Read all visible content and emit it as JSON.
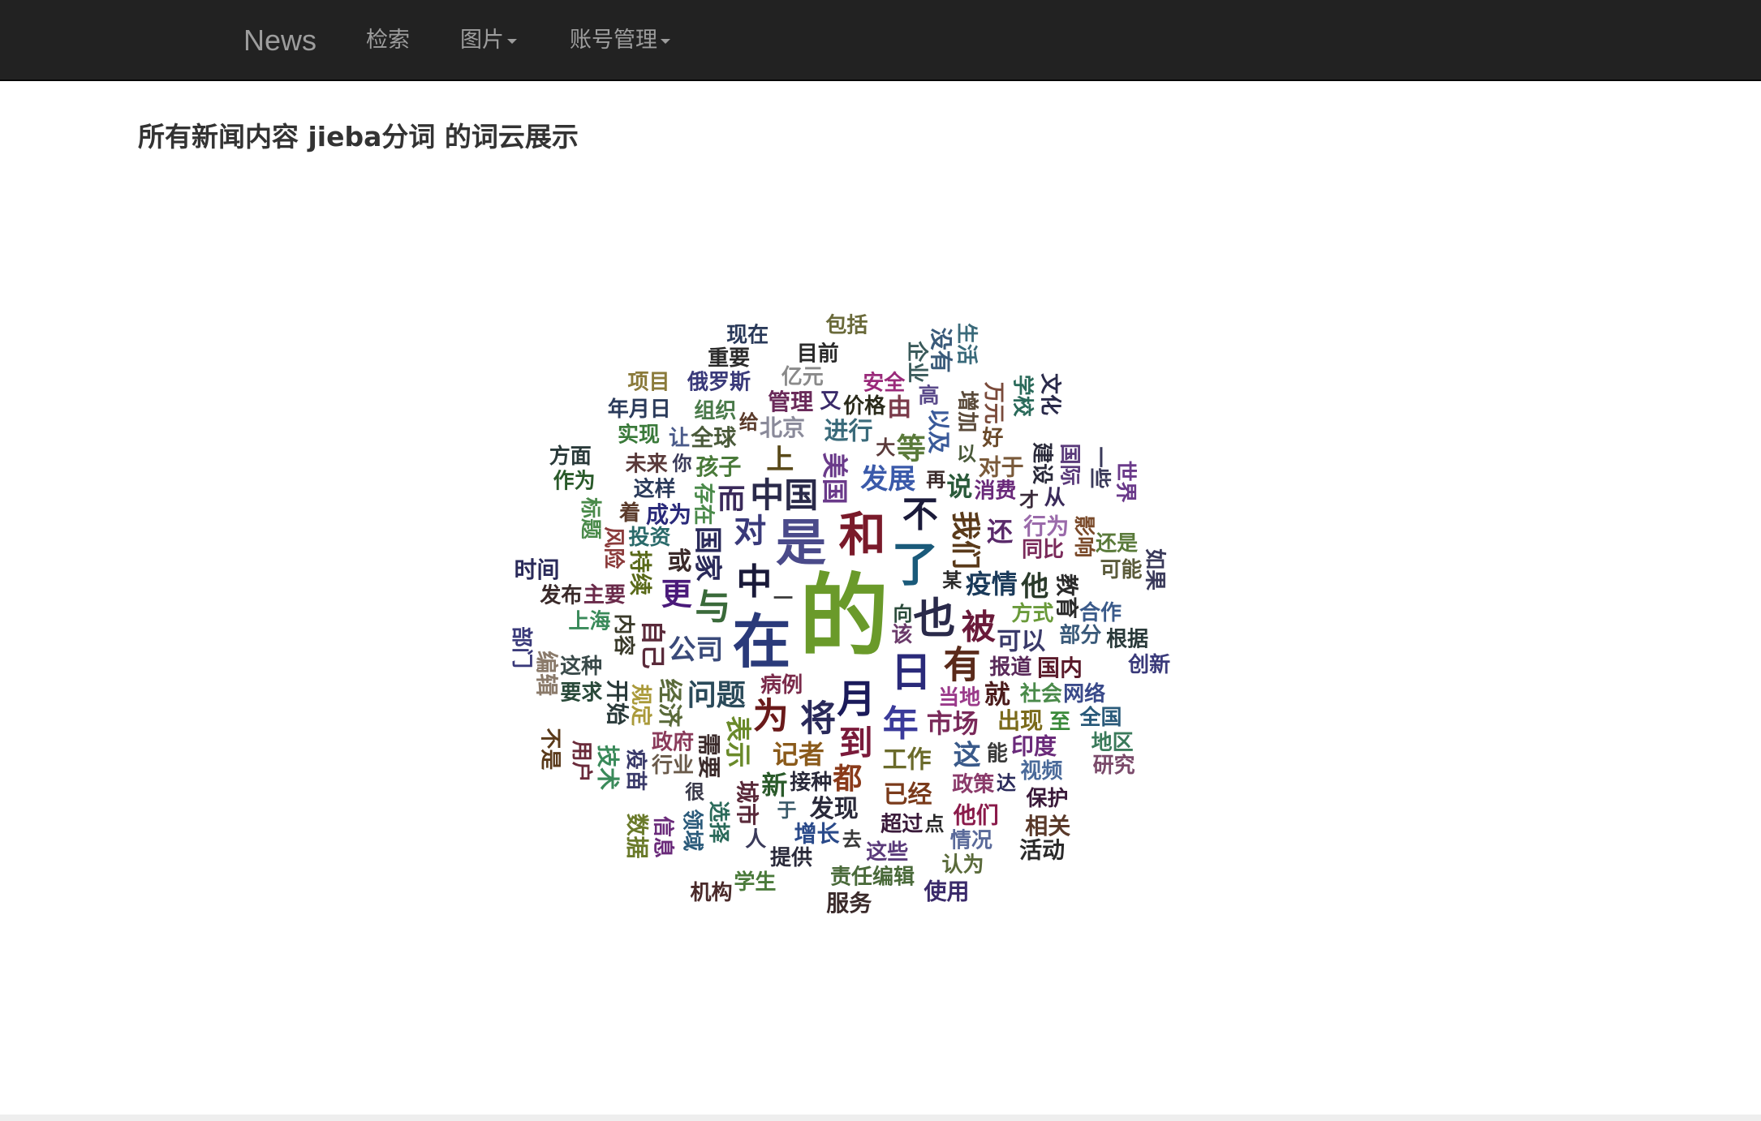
{
  "navbar": {
    "brand": "News",
    "search": "检索",
    "images": "图片",
    "account": "账号管理"
  },
  "page": {
    "title": "所有新闻内容 jieba分词 的词云展示"
  },
  "colors": {
    "navbar_bg": "#222222",
    "nav_text": "#9d9d9d",
    "title_text": "#333333"
  },
  "wordcloud": {
    "words": [
      {
        "text": "的",
        "size": 110,
        "color": "#6a9a2a"
      },
      {
        "text": "在",
        "size": 72,
        "color": "#2a3a7a"
      },
      {
        "text": "是",
        "size": 62,
        "color": "#4a4a8a"
      },
      {
        "text": "和",
        "size": 58,
        "color": "#7a1a2a"
      },
      {
        "text": "了",
        "size": 58,
        "color": "#1a5a7a"
      },
      {
        "text": "也",
        "size": 52,
        "color": "#2a2a4a"
      },
      {
        "text": "日",
        "size": 50,
        "color": "#2a2a7a"
      },
      {
        "text": "月",
        "size": 48,
        "color": "#1a1a5a"
      },
      {
        "text": "中",
        "size": 44,
        "color": "#1a1a3a"
      },
      {
        "text": "将",
        "size": 44,
        "color": "#2a2a5a"
      },
      {
        "text": "有",
        "size": 46,
        "color": "#5a2a1a"
      },
      {
        "text": "年",
        "size": 44,
        "color": "#3a3a9a"
      },
      {
        "text": "为",
        "size": 44,
        "color": "#6a1a1a"
      },
      {
        "text": "与",
        "size": 44,
        "color": "#3a6a3a"
      },
      {
        "text": "对",
        "size": 40,
        "color": "#3a3a7a"
      },
      {
        "text": "不",
        "size": 44,
        "color": "#1a1a3a"
      },
      {
        "text": "被",
        "size": 42,
        "color": "#6a1a3a"
      },
      {
        "text": "到",
        "size": 42,
        "color": "#7a1a3a"
      },
      {
        "text": "中国",
        "size": 42,
        "color": "#2a2a4a"
      },
      {
        "text": "我们",
        "size": 36,
        "color": "#5a3a1a"
      },
      {
        "text": "问题",
        "size": 36,
        "color": "#2a4a5a"
      },
      {
        "text": "公司",
        "size": 34,
        "color": "#3a4a7a"
      },
      {
        "text": "国家",
        "size": 34,
        "color": "#2a2a5a"
      },
      {
        "text": "发展",
        "size": 34,
        "color": "#3a5aaa"
      },
      {
        "text": "市场",
        "size": 32,
        "color": "#7a2a5a"
      },
      {
        "text": "美国",
        "size": 32,
        "color": "#6a3a8a"
      },
      {
        "text": "疫情",
        "size": 32,
        "color": "#1a3a5a"
      },
      {
        "text": "记者",
        "size": 32,
        "color": "#8a5a1a"
      },
      {
        "text": "表示",
        "size": 32,
        "color": "#6a8a2a"
      },
      {
        "text": "工作",
        "size": 30,
        "color": "#6a6a2a"
      },
      {
        "text": "可以",
        "size": 30,
        "color": "#3a3a6a"
      },
      {
        "text": "更",
        "size": 38,
        "color": "#4a1a7a"
      },
      {
        "text": "而",
        "size": 34,
        "color": "#3a2a5a"
      },
      {
        "text": "就",
        "size": 32,
        "color": "#4a1a1a"
      },
      {
        "text": "都",
        "size": 36,
        "color": "#8a3a1a"
      },
      {
        "text": "上",
        "size": 34,
        "color": "#5a4a1a"
      },
      {
        "text": "说",
        "size": 32,
        "color": "#2a5a3a"
      },
      {
        "text": "还",
        "size": 32,
        "color": "#5a2a6a"
      },
      {
        "text": "等",
        "size": 36,
        "color": "#5a7a3a"
      },
      {
        "text": "他",
        "size": 34,
        "color": "#2a3a2a"
      },
      {
        "text": "这",
        "size": 34,
        "color": "#3a5a8a"
      },
      {
        "text": "新",
        "size": 32,
        "color": "#2a5a2a"
      },
      {
        "text": "进行",
        "size": 30,
        "color": "#3a6a7a"
      },
      {
        "text": "自己",
        "size": 30,
        "color": "#5a2a3a"
      },
      {
        "text": "已经",
        "size": 30,
        "color": "#7a3a1a"
      },
      {
        "text": "成为",
        "size": 28,
        "color": "#2a2a7a"
      },
      {
        "text": "需要",
        "size": 28,
        "color": "#3a2a2a"
      },
      {
        "text": "孩子",
        "size": 28,
        "color": "#4a7a3a"
      },
      {
        "text": "出现",
        "size": 28,
        "color": "#7a6a1a"
      },
      {
        "text": "经济",
        "size": 30,
        "color": "#5a6a3a"
      },
      {
        "text": "发现",
        "size": 30,
        "color": "#2a2a3a"
      },
      {
        "text": "北京",
        "size": 28,
        "color": "#8a8a9a"
      },
      {
        "text": "持续",
        "size": 28,
        "color": "#5a6a1a"
      },
      {
        "text": "对于",
        "size": 28,
        "color": "#7a5a3a"
      },
      {
        "text": "行为",
        "size": 28,
        "color": "#9a6aaa"
      },
      {
        "text": "教育",
        "size": 28,
        "color": "#2a2a2a"
      },
      {
        "text": "国内",
        "size": 28,
        "color": "#5a1a2a"
      },
      {
        "text": "政策",
        "size": 26,
        "color": "#8a3a6a"
      },
      {
        "text": "规定",
        "size": 26,
        "color": "#aa9a3a"
      },
      {
        "text": "价格",
        "size": 26,
        "color": "#2a2a1a"
      },
      {
        "text": "超过",
        "size": 26,
        "color": "#3a1a3a"
      },
      {
        "text": "内容",
        "size": 26,
        "color": "#3a3a2a"
      },
      {
        "text": "这样",
        "size": 26,
        "color": "#2a3a5a"
      },
      {
        "text": "全球",
        "size": 28,
        "color": "#4a5a3a"
      },
      {
        "text": "以及",
        "size": 28,
        "color": "#3a5a9a"
      },
      {
        "text": "印度",
        "size": 28,
        "color": "#6a2a7a"
      },
      {
        "text": "增长",
        "size": 28,
        "color": "#2a4a8a"
      },
      {
        "text": "城市",
        "size": 28,
        "color": "#5a2a3a"
      },
      {
        "text": "行业",
        "size": 26,
        "color": "#6a5a4a"
      },
      {
        "text": "管理",
        "size": 28,
        "color": "#6a2a5a"
      },
      {
        "text": "开始",
        "size": 28,
        "color": "#2a3a3a"
      },
      {
        "text": "他们",
        "size": 28,
        "color": "#8a1a4a"
      },
      {
        "text": "上海",
        "size": 26,
        "color": "#3a8a5a"
      },
      {
        "text": "风险",
        "size": 26,
        "color": "#8a3a3a"
      },
      {
        "text": "安全",
        "size": 26,
        "color": "#9a2a7a"
      },
      {
        "text": "合作",
        "size": 26,
        "color": "#3a5a8a"
      },
      {
        "text": "增加",
        "size": 26,
        "color": "#5a4a3a"
      },
      {
        "text": "网络",
        "size": 26,
        "color": "#3a4a8a"
      },
      {
        "text": "病例",
        "size": 26,
        "color": "#7a2a4a"
      },
      {
        "text": "选择",
        "size": 26,
        "color": "#2a6a5a"
      },
      {
        "text": "未来",
        "size": 26,
        "color": "#5a3a3a"
      },
      {
        "text": "组织",
        "size": 26,
        "color": "#4a7a4a"
      },
      {
        "text": "建设",
        "size": 26,
        "color": "#2a2a3a"
      },
      {
        "text": "视频",
        "size": 26,
        "color": "#4a6a9a"
      },
      {
        "text": "这些",
        "size": 26,
        "color": "#5a3a7a"
      },
      {
        "text": "影响",
        "size": 26,
        "color": "#7a4a2a"
      },
      {
        "text": "亿元",
        "size": 26,
        "color": "#8a8a8a"
      },
      {
        "text": "提供",
        "size": 26,
        "color": "#2a2a3a"
      },
      {
        "text": "疫苗",
        "size": 26,
        "color": "#3a3a6a"
      },
      {
        "text": "情况",
        "size": 26,
        "color": "#5a6a9a"
      },
      {
        "text": "要求",
        "size": 26,
        "color": "#2a4a3a"
      },
      {
        "text": "标题",
        "size": 26,
        "color": "#4a8a4a"
      },
      {
        "text": "全国",
        "size": 26,
        "color": "#2a5a7a"
      },
      {
        "text": "实现",
        "size": 26,
        "color": "#3a7a3a"
      },
      {
        "text": "万元",
        "size": 26,
        "color": "#7a4a3a"
      },
      {
        "text": "俄罗斯",
        "size": 26,
        "color": "#3a3a7a"
      },
      {
        "text": "还是",
        "size": 26,
        "color": "#5a7a3a"
      },
      {
        "text": "领域",
        "size": 26,
        "color": "#2a5a7a"
      },
      {
        "text": "保护",
        "size": 26,
        "color": "#3a1a3a"
      },
      {
        "text": "责任编辑",
        "size": 26,
        "color": "#4a6a3a"
      },
      {
        "text": "国际",
        "size": 26,
        "color": "#5a3a7a"
      },
      {
        "text": "发布",
        "size": 26,
        "color": "#3a2a2a"
      },
      {
        "text": "目前",
        "size": 26,
        "color": "#2a2a2a"
      },
      {
        "text": "企业",
        "size": 26,
        "color": "#3a5a5a"
      },
      {
        "text": "消费",
        "size": 26,
        "color": "#6a2a7a"
      },
      {
        "text": "根据",
        "size": 26,
        "color": "#2a3a3a"
      },
      {
        "text": "技术",
        "size": 28,
        "color": "#3a8a5a"
      },
      {
        "text": "认为",
        "size": 26,
        "color": "#5a6a3a"
      },
      {
        "text": "地区",
        "size": 26,
        "color": "#3a7a5a"
      },
      {
        "text": "学校",
        "size": 26,
        "color": "#2a6a5a"
      },
      {
        "text": "学生",
        "size": 26,
        "color": "#4a7a3a"
      },
      {
        "text": "年月日",
        "size": 26,
        "color": "#2a3a5a"
      },
      {
        "text": "信息",
        "size": 26,
        "color": "#6a2a7a"
      },
      {
        "text": "重要",
        "size": 26,
        "color": "#2a2a2a"
      },
      {
        "text": "相关",
        "size": 28,
        "color": "#5a3a2a"
      },
      {
        "text": "一些",
        "size": 26,
        "color": "#3a3a5a"
      },
      {
        "text": "作为",
        "size": 26,
        "color": "#2a5a2a"
      },
      {
        "text": "同比",
        "size": 26,
        "color": "#7a2a5a"
      },
      {
        "text": "编辑",
        "size": 28,
        "color": "#8a7a6a"
      },
      {
        "text": "服务",
        "size": 28,
        "color": "#3a2a2a"
      },
      {
        "text": "时间",
        "size": 28,
        "color": "#2a2a5a"
      },
      {
        "text": "没有",
        "size": 28,
        "color": "#3a5a7a"
      },
      {
        "text": "报道",
        "size": 26,
        "color": "#5a2a5a"
      },
      {
        "text": "方式",
        "size": 26,
        "color": "#6a9a3a"
      },
      {
        "text": "用户",
        "size": 26,
        "color": "#6a2a3a"
      },
      {
        "text": "政府",
        "size": 26,
        "color": "#8a3a5a"
      },
      {
        "text": "创新",
        "size": 26,
        "color": "#3a3a7a"
      },
      {
        "text": "文化",
        "size": 26,
        "color": "#2a2a4a"
      },
      {
        "text": "包括",
        "size": 26,
        "color": "#6a6a3a"
      },
      {
        "text": "当地",
        "size": 26,
        "color": "#9a3a8a"
      },
      {
        "text": "如果",
        "size": 26,
        "color": "#3a3a5a"
      },
      {
        "text": "研究",
        "size": 26,
        "color": "#7a4a6a"
      },
      {
        "text": "使用",
        "size": 28,
        "color": "#3a2a6a"
      },
      {
        "text": "数据",
        "size": 28,
        "color": "#6a7a2a"
      },
      {
        "text": "活动",
        "size": 28,
        "color": "#2a2a2a"
      },
      {
        "text": "方面",
        "size": 26,
        "color": "#2a3a3a"
      },
      {
        "text": "或",
        "size": 30,
        "color": "#3a2a2a"
      },
      {
        "text": "由",
        "size": 30,
        "color": "#7a3a4a"
      },
      {
        "text": "接种",
        "size": 26,
        "color": "#2a2a3a"
      },
      {
        "text": "存在",
        "size": 26,
        "color": "#4a8a4a"
      },
      {
        "text": "项目",
        "size": 26,
        "color": "#8a7a3a"
      },
      {
        "text": "现在",
        "size": 26,
        "color": "#2a3a5a"
      },
      {
        "text": "生活",
        "size": 26,
        "color": "#3a6a7a"
      },
      {
        "text": "社会",
        "size": 26,
        "color": "#4a8a4a"
      },
      {
        "text": "部分",
        "size": 26,
        "color": "#3a5a7a"
      },
      {
        "text": "世界",
        "size": 26,
        "color": "#6a3a8a"
      },
      {
        "text": "主要",
        "size": 26,
        "color": "#6a2a4a"
      },
      {
        "text": "机构",
        "size": 26,
        "color": "#4a2a2a"
      },
      {
        "text": "不是",
        "size": 26,
        "color": "#5a3a1a"
      },
      {
        "text": "投资",
        "size": 26,
        "color": "#2a6a6a"
      },
      {
        "text": "这种",
        "size": 26,
        "color": "#3a4a4a"
      },
      {
        "text": "部门",
        "size": 26,
        "color": "#3a3a7a"
      },
      {
        "text": "可能",
        "size": 26,
        "color": "#5a5a3a"
      },
      {
        "text": "能",
        "size": 26,
        "color": "#3a3a3a"
      },
      {
        "text": "你",
        "size": 24,
        "color": "#3a3a5a"
      },
      {
        "text": "给",
        "size": 24,
        "color": "#5a3a2a"
      },
      {
        "text": "向",
        "size": 24,
        "color": "#2a4a3a"
      },
      {
        "text": "再",
        "size": 24,
        "color": "#3a2a2a"
      },
      {
        "text": "大",
        "size": 24,
        "color": "#5a3a3a"
      },
      {
        "text": "以",
        "size": 24,
        "color": "#4a5a3a"
      },
      {
        "text": "一",
        "size": 24,
        "color": "#3a3a3a"
      },
      {
        "text": "于",
        "size": 24,
        "color": "#3a5a6a"
      },
      {
        "text": "才",
        "size": 24,
        "color": "#3a2a3a"
      },
      {
        "text": "又",
        "size": 26,
        "color": "#3a2a6a"
      },
      {
        "text": "着",
        "size": 26,
        "color": "#5a3a2a"
      },
      {
        "text": "好",
        "size": 26,
        "color": "#6a4a2a"
      },
      {
        "text": "至",
        "size": 26,
        "color": "#3a8a3a"
      },
      {
        "text": "某",
        "size": 24,
        "color": "#2a2a2a"
      },
      {
        "text": "达",
        "size": 24,
        "color": "#2a2a5a"
      },
      {
        "text": "点",
        "size": 24,
        "color": "#2a2a2a"
      },
      {
        "text": "去",
        "size": 24,
        "color": "#3a3a3a"
      },
      {
        "text": "很",
        "size": 24,
        "color": "#3a3a4a"
      },
      {
        "text": "从",
        "size": 26,
        "color": "#3a2a5a"
      },
      {
        "text": "让",
        "size": 26,
        "color": "#4a5a8a"
      },
      {
        "text": "该",
        "size": 26,
        "color": "#6a3a6a"
      },
      {
        "text": "高",
        "size": 26,
        "color": "#5a4a8a"
      },
      {
        "text": "人",
        "size": 26,
        "color": "#3a3a5a"
      }
    ]
  }
}
